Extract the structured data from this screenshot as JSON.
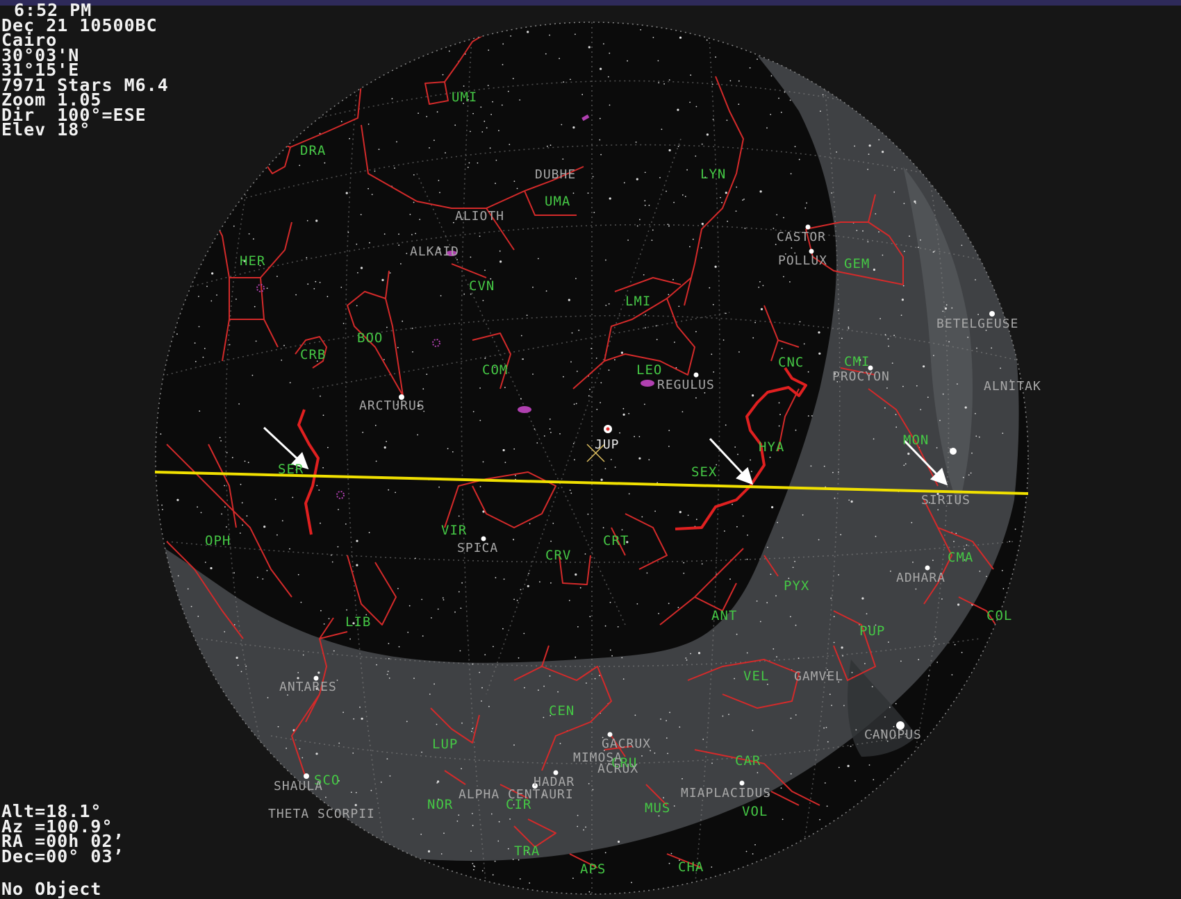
{
  "status": {
    "time": "6:52 PM",
    "date": "Dec 21 10500BC",
    "location": "Cairo",
    "latitude": "30°03'N",
    "longitude": "31°15'E",
    "stars": "7971 Stars M6.4",
    "zoom": "Zoom 1.05",
    "direction": "Dir  100°=ESE",
    "elevation": "Elev 18°"
  },
  "cursor": {
    "alt": "Alt=18.1°",
    "az": "Az =100.9°",
    "ra": "RA =00h 02’",
    "dec": "Dec=00° 03’"
  },
  "selection": "No Object",
  "colors": {
    "background": "#161616",
    "sky": "#0b0b0b",
    "milky_way": "#4a4d50",
    "constellation_lines": "#d42a2a",
    "constellation_labels": "#45c845",
    "star_labels": "#a8a8a8",
    "horizon_line": "#f0e000",
    "hydra_highlight": "#e02020",
    "arrows": "#ffffff",
    "deep_sky": "#b040b0"
  },
  "constellations": {
    "umi": "UMI",
    "dra": "DRA",
    "lyn": "LYN",
    "uma": "UMA",
    "her": "HER",
    "gem": "GEM",
    "cvn": "CVN",
    "lmi": "LMI",
    "crb": "CRB",
    "boo": "BOO",
    "com": "COM",
    "leo": "LEO",
    "cnc": "CNC",
    "cmi": "CMI",
    "hya": "HYA",
    "mon": "MON",
    "ser": "SER",
    "sex": "SEX",
    "oph": "OPH",
    "vir": "VIR",
    "crt": "CRT",
    "crv": "CRV",
    "cma": "CMA",
    "pyx": "PYX",
    "lib": "LIB",
    "ant": "ANT",
    "pup": "PUP",
    "col": "COL",
    "vel": "VEL",
    "cen": "CEN",
    "lup": "LUP",
    "cru": "CRU",
    "car": "CAR",
    "sco": "SCO",
    "nor": "NOR",
    "cir": "CIR",
    "mus": "MUS",
    "vol": "VOL",
    "tra": "TRA",
    "aps": "APS",
    "cha": "CHA"
  },
  "stars": {
    "dubhe": "DUBHE",
    "alioth": "ALIOTH",
    "alkaid": "ALKAID",
    "castor": "CASTOR",
    "pollux": "POLLUX",
    "betelgeuse": "BETELGEUSE",
    "alnitak": "ALNITAK",
    "procyon": "PROCYON",
    "regulus": "REGULUS",
    "arcturus": "ARCTURUS",
    "jupiter": "JUP",
    "sirius": "SIRIUS",
    "spica": "SPICA",
    "adhara": "ADHARA",
    "antares": "ANTARES",
    "gamvel": "GAMVEL",
    "canopus": "CANOPUS",
    "gacrux": "GACRUX",
    "mimosa": "MIMOSA",
    "acrux": "ACRUX",
    "hadar": "HADAR",
    "alpha_centauri": "ALPHA CENTAURI",
    "miaplacidus": "MIAPLACIDUS",
    "shaula": "SHAULA",
    "theta_scorpii": "THETA SCORPII"
  }
}
